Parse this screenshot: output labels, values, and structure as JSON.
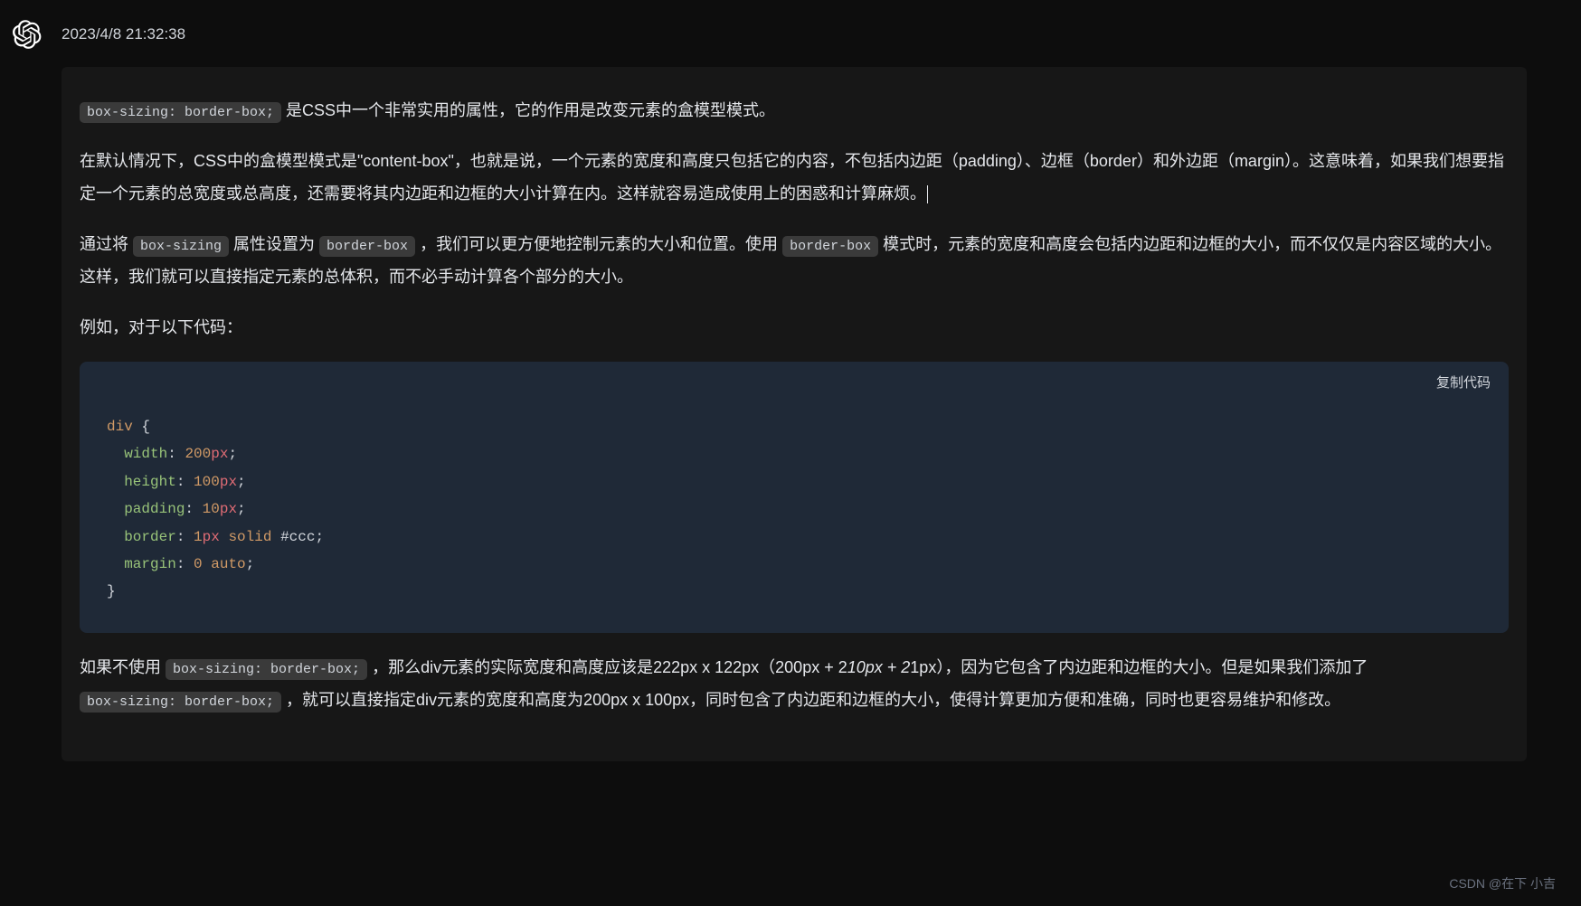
{
  "timestamp": "2023/4/8 21:32:38",
  "inline_codes": {
    "box_sizing": "box-sizing: border-box;",
    "box_sizing_prop": "box-sizing",
    "border_box": "border-box"
  },
  "paragraphs": {
    "p1_after": " 是CSS中一个非常实用的属性，它的作用是改变元素的盒模型模式。",
    "p2": "在默认情况下，CSS中的盒模型模式是\"content-box\"，也就是说，一个元素的宽度和高度只包括它的内容，不包括内边距（padding）、边框（border）和外边距（margin）。这意味着，如果我们想要指定一个元素的总宽度或总高度，还需要将其内边距和边框的大小计算在内。这样就容易造成使用上的困惑和计算麻烦。",
    "p3_a": "通过将 ",
    "p3_b": " 属性设置为 ",
    "p3_c": " ，我们可以更方便地控制元素的大小和位置。使用 ",
    "p3_d": " 模式时，元素的宽度和高度会包括内边距和边框的大小，而不仅仅是内容区域的大小。这样，我们就可以直接指定元素的总体积，而不必手动计算各个部分的大小。",
    "p4": "例如，对于以下代码：",
    "p5_a": "如果不使用 ",
    "p5_b": " ，那么div元素的实际宽度和高度应该是222px x 122px（200px + 2",
    "p5_c": "10px + 2",
    "p5_d": "1px），因为它包含了内边距和边框的大小。但是如果我们添加了 ",
    "p5_e": " ，就可以直接指定div元素的宽度和高度为200px x 100px，同时包含了内边距和边框的大小，使得计算更加方便和准确，同时也更容易维护和修改。"
  },
  "code": {
    "copy_label": "复制代码",
    "selector": "div",
    "lines": [
      {
        "prop": "width",
        "value": "200",
        "unit": "px"
      },
      {
        "prop": "height",
        "value": "100",
        "unit": "px"
      },
      {
        "prop": "padding",
        "value": "10",
        "unit": "px"
      }
    ],
    "border_prop": "border",
    "border_val_num": "1",
    "border_val_unit": "px",
    "border_solid": "solid",
    "border_color": "#ccc",
    "margin_prop": "margin",
    "margin_zero": "0",
    "margin_auto": "auto"
  },
  "watermark": "CSDN @在下 小吉"
}
